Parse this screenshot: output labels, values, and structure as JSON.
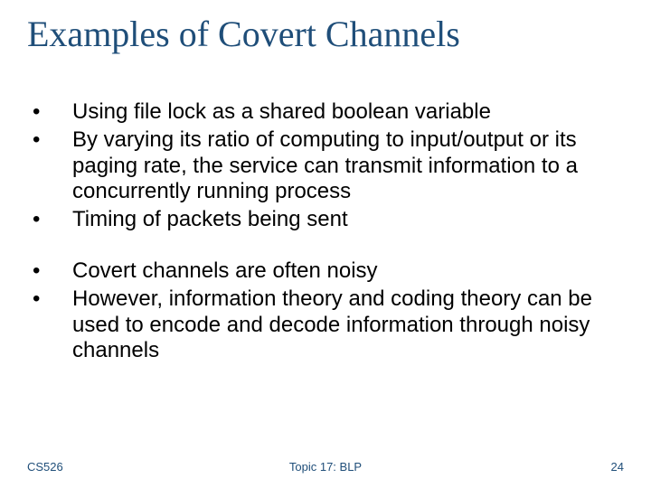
{
  "title": "Examples of Covert Channels",
  "group1": [
    "Using file lock as a shared boolean variable",
    "By varying its ratio of computing to input/output or its paging rate, the service can transmit information to a concurrently running process",
    "Timing of packets being sent"
  ],
  "group2": [
    "Covert channels are often noisy",
    "However, information theory and coding theory can be used to encode and decode information through noisy channels"
  ],
  "footer": {
    "left": "CS526",
    "center": "Topic 17: BLP",
    "right": "24"
  }
}
